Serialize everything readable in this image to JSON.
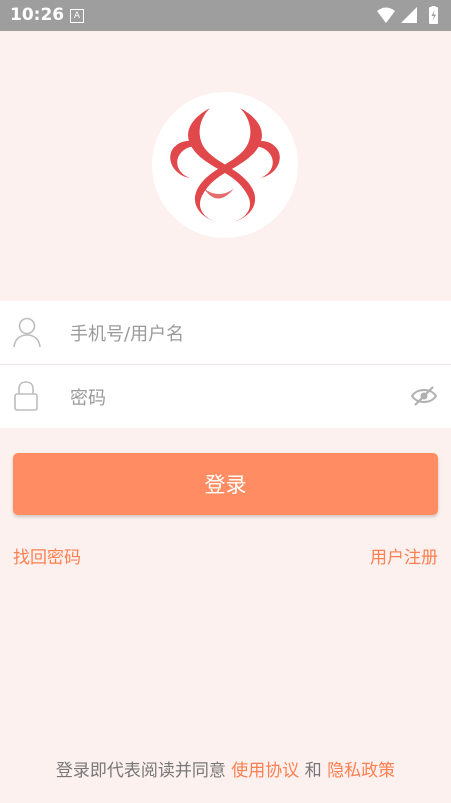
{
  "status_bar": {
    "time": "10:26",
    "notification_icon": "A",
    "icons": [
      "wifi-icon",
      "signal-icon",
      "battery-icon"
    ]
  },
  "login": {
    "username_placeholder": "手机号/用户名",
    "password_placeholder": "密码",
    "login_button": "登录",
    "forgot_password": "找回密码",
    "register": "用户注册"
  },
  "agreement": {
    "prefix": "登录即代表阅读并同意",
    "terms": "使用协议",
    "conjunction": "和",
    "privacy": "隐私政策"
  },
  "colors": {
    "accent": "#ff8c62",
    "link": "#ff7f50",
    "logo": "#e0484b",
    "background": "#fcf1ef"
  }
}
